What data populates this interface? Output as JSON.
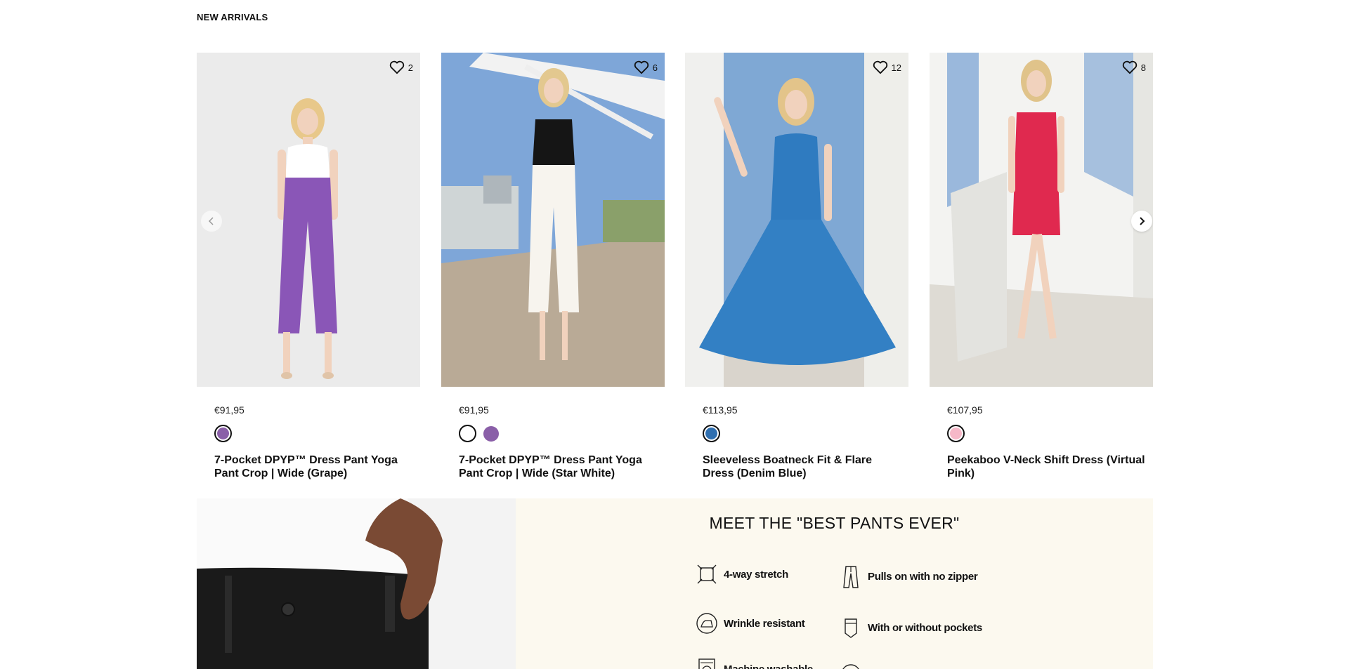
{
  "section": {
    "title": "NEW ARRIVALS"
  },
  "products": [
    {
      "likes": "2",
      "price": "€91,95",
      "name": "7-Pocket DPYP™ Dress Pant Yoga Pant Crop | Wide (Grape)",
      "swatches": [
        {
          "color": "#8a5fa8",
          "selected": true
        }
      ]
    },
    {
      "likes": "6",
      "price": "€91,95",
      "name": "7-Pocket DPYP™ Dress Pant Yoga Pant Crop | Wide (Star White)",
      "swatches": [
        {
          "color": "#ffffff",
          "selected": true
        },
        {
          "color": "#8a5fa8",
          "selected": false
        }
      ]
    },
    {
      "likes": "12",
      "price": "€113,95",
      "name": "Sleeveless Boatneck Fit & Flare Dress (Denim Blue)",
      "swatches": [
        {
          "color": "#2f6fb0",
          "selected": true
        }
      ]
    },
    {
      "likes": "8",
      "price": "€107,95",
      "name": "Peekaboo V-Neck Shift Dress (Virtual Pink)",
      "swatches": [
        {
          "color": "#f6b8c8",
          "selected": true
        }
      ]
    }
  ],
  "promo": {
    "title": "MEET THE \"BEST PANTS EVER\"",
    "features": [
      {
        "label": "4-way stretch",
        "icon": "stretch-icon"
      },
      {
        "label": "Pulls on with no zipper",
        "icon": "pants-icon"
      },
      {
        "label": "Wrinkle resistant",
        "icon": "iron-icon"
      },
      {
        "label": "With or without pockets",
        "icon": "pocket-icon"
      },
      {
        "label": "Machine washable",
        "icon": "washing-machine-icon"
      }
    ]
  },
  "colors": {
    "promo_bg": "#fcf9ef",
    "text": "#111111"
  }
}
